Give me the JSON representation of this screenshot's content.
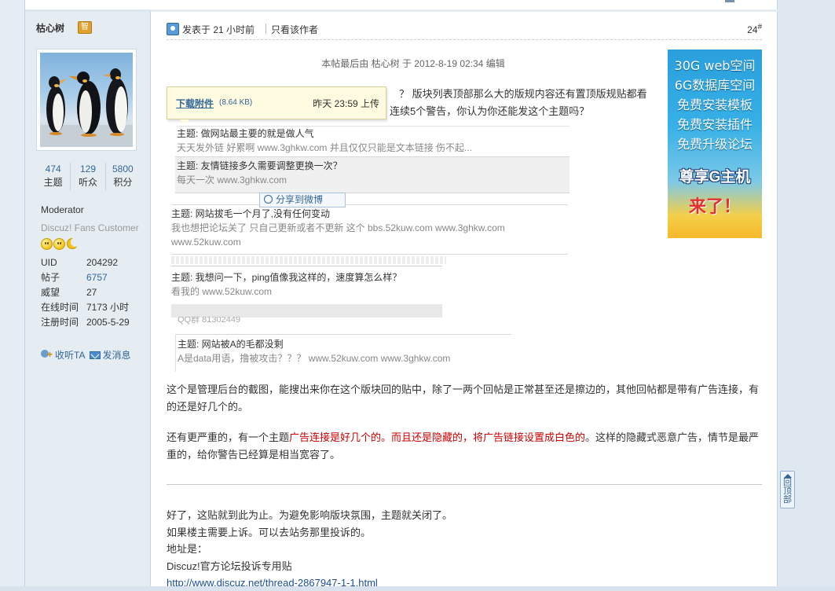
{
  "author": {
    "name": "枯心树",
    "badge": "智",
    "stats": [
      {
        "num": "474",
        "label": "主题"
      },
      {
        "num": "129",
        "label": "听众"
      },
      {
        "num": "5800",
        "label": "积分"
      }
    ],
    "group": "Moderator",
    "group_sub": "Discuz! Fans Customer",
    "info": [
      {
        "label": "UID",
        "value": "204292"
      },
      {
        "label": "帖子",
        "value": "6757"
      },
      {
        "label": "威望",
        "value": "27"
      },
      {
        "label": "在线时间",
        "value": "7173 小时"
      },
      {
        "label": "注册时间",
        "value": "2005-5-29"
      }
    ],
    "follow_label": "收听TA",
    "message_label": "发消息"
  },
  "post": {
    "time": "发表于 21 小时前",
    "only_author": "只看该作者",
    "floor": "24",
    "floor_sup": "#",
    "edit_note": "本帖最后由 枯心树 于 2012-8-19 02:34 编辑",
    "text_top1": "？ 版块列表顶部那么大的版规内容还有置顶版规贴都看",
    "text_top2": "连续5个警告，你认为你还能发这个主题吗？",
    "download": {
      "title": "下载附件",
      "size": "(8.64 KB)",
      "time": "昨天 23:59 上传"
    },
    "share_label": "分享到微博",
    "items": [
      {
        "title": "主题:  做网站最主要的就是做人气",
        "sub": "天天发外链 好累啊 www.3ghkw.com 并且仅仅只能是文本链接 伤不起..."
      },
      {
        "title": "主题:  友情链接多久需要调整更换一次？",
        "sub": "每天一次 www.3ghkw.com"
      },
      {
        "title": "主题:  网站拔毛一个月了,没有任何变动",
        "sub": "我也想把论坛关了 只自己更新或者不更新 这个 bbs.52kuw.com www.3ghkw.com",
        "sub2": "www.52kuw.com"
      },
      {
        "title": "主题:  我想问一下，ping值像我这样的，速度算怎么样？",
        "sub": "看我的 www.52kuw.com"
      },
      {
        "title": "主题:  网站被A的毛都没剩",
        "sub": "A是data用语，撸被攻击？？？ www.52kuw.com www.3ghkw.com"
      }
    ],
    "qq_fragment": "QQ群 81302449",
    "p1": "这个是管理后台的截图，能搜出来你在这个版块回的贴中，除了一两个回帖是正常甚至还是擦边的，其他回帖都是带有广告连接，有的还是好几个的。",
    "p2_a": "还有更严重的，有一个主题",
    "p2_red": "广告连接是好几个的。而且还是隐藏的，将广告链接设置成白色的",
    "p2_b": "。这样的隐藏式恶意广告，情节是最严重的，给你警告已经算是相当宽容了。",
    "p3_lines": [
      "好了，这贴就到此为止。为避免影响版块氛围，主题就关闭了。",
      "如果楼主需要上诉。可以去站务那里投诉的。",
      "地址是：",
      "Discuz!官方论坛投诉专用贴"
    ],
    "link": "http://www.discuz.net/thread-2867947-1-1.html"
  },
  "ad": {
    "lines": [
      "30G web空间",
      "6G数据库空间",
      "免费安装模板",
      "免费安装插件",
      "免费升级论坛"
    ],
    "big": "尊享G主机",
    "come": "来了！"
  },
  "back_to_top": "回顶部"
}
